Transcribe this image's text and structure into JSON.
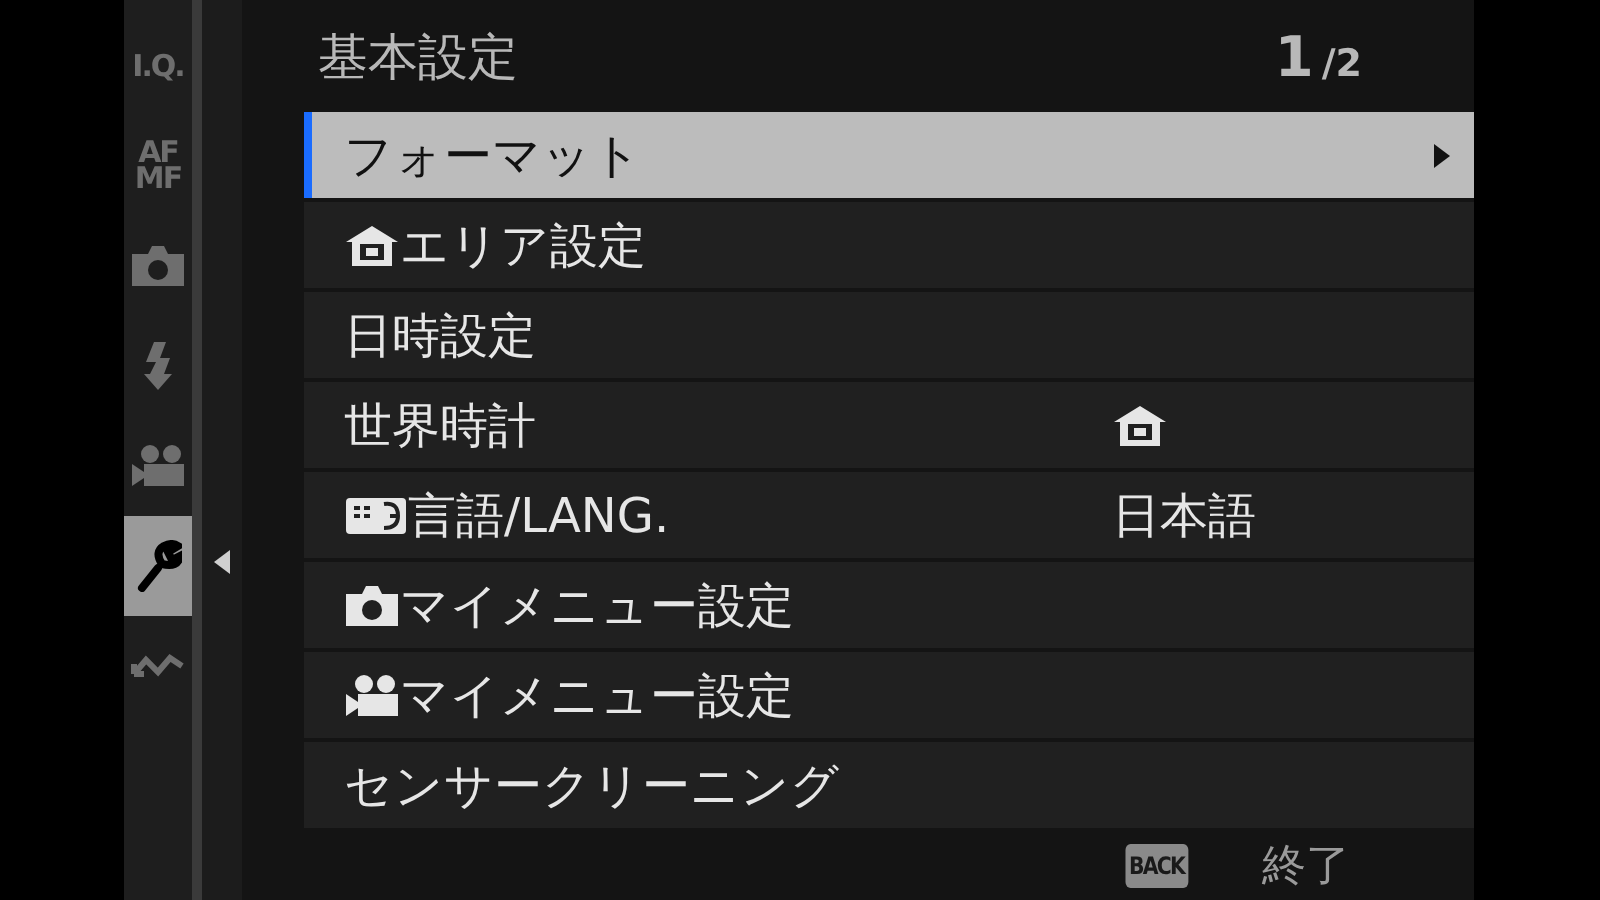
{
  "sidebar": {
    "tabs": [
      {
        "kind": "text",
        "lines": [
          "I.Q."
        ],
        "selected": false
      },
      {
        "kind": "text",
        "lines": [
          "AF",
          "MF"
        ],
        "selected": false
      },
      {
        "kind": "camera",
        "selected": false
      },
      {
        "kind": "flash",
        "selected": false
      },
      {
        "kind": "movie",
        "selected": false
      },
      {
        "kind": "wrench",
        "selected": true
      },
      {
        "kind": "wave",
        "selected": false
      }
    ]
  },
  "header": {
    "title": "基本設定",
    "page": "1",
    "page_total": "/2"
  },
  "rows": [
    {
      "kind": "text",
      "label": "フォーマット",
      "selected": true
    },
    {
      "kind": "home",
      "label": "エリア設定",
      "selected": false
    },
    {
      "kind": "text",
      "label": "日時設定",
      "selected": false
    },
    {
      "kind": "home-value",
      "label": "世界時計",
      "selected": false
    },
    {
      "kind": "language",
      "label": "言語/LANG.",
      "value": "日本語",
      "selected": false
    },
    {
      "kind": "camera",
      "label": "マイメニュー設定",
      "selected": false
    },
    {
      "kind": "movie",
      "label": "マイメニュー設定",
      "selected": false
    },
    {
      "kind": "text",
      "label": "センサークリーニング",
      "selected": false
    }
  ],
  "footer": {
    "key": "BACK",
    "label": "終了"
  }
}
